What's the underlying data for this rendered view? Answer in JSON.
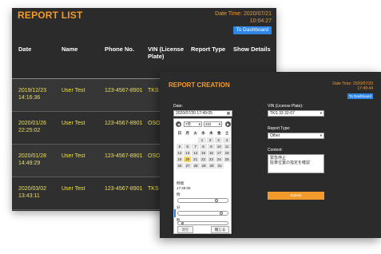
{
  "report_list": {
    "title": "REPORT LIST",
    "datetime_line1": "Date Time: 2020/07/21",
    "datetime_line2": "10:04:27",
    "dashboard_label": "To Dashboard",
    "headers": {
      "date": "Date",
      "name": "Name",
      "phone": "Phone No.",
      "vin": "VIN (License Plate)",
      "report_type": "Report Type",
      "show_details": "Show Details"
    },
    "rows": [
      {
        "date": "2019/12/23",
        "time": "14:16:36",
        "name": "User Test",
        "phone": "123-4567-8901",
        "vin": "TKS"
      },
      {
        "date": "2020/01/26",
        "time": "22:25:02",
        "name": "User Test",
        "phone": "123-4567-8901",
        "vin": "OSO"
      },
      {
        "date": "2020/01/28",
        "time": "14:49:29",
        "name": "User Test",
        "phone": "123-4567-8901",
        "vin": "OSO"
      },
      {
        "date": "2020/03/02",
        "time": "13:43:11",
        "name": "User Test",
        "phone": "123-4567-8901",
        "vin": "TKS"
      }
    ]
  },
  "report_creation": {
    "title": "REPORT CREATION",
    "datetime_line1": "Date Time: 2020/07/20",
    "datetime_line2": "17:49:44",
    "dashboard_label": "To Dashboard",
    "date_label": "Date:",
    "date_value": "2020/07/20 17:49:05",
    "vin_label": "VIN (License Plate):",
    "vin_value": "TKS 33 32-07",
    "report_type_label": "Report Type:",
    "report_type_value": "Other",
    "content_label": "Content:",
    "content_line1": "緊急停止",
    "content_line2": "駐車位置の指定を確認",
    "submit_label": "Submit",
    "picker": {
      "month": "7月",
      "year": "202",
      "weekdays": [
        "日",
        "月",
        "火",
        "水",
        "木",
        "金",
        "土"
      ],
      "weeks": [
        [
          "",
          "",
          "",
          "1",
          "2",
          "3",
          "4"
        ],
        [
          "5",
          "6",
          "7",
          "8",
          "9",
          "10",
          "11"
        ],
        [
          "12",
          "13",
          "14",
          "15",
          "16",
          "17",
          "18"
        ],
        [
          "19",
          "20",
          "21",
          "22",
          "23",
          "24",
          "25"
        ],
        [
          "26",
          "27",
          "28",
          "29",
          "30",
          "31",
          ""
        ]
      ],
      "current_day": "20",
      "time_heading": "時間",
      "time_value": "17:49:05",
      "hour_label": "時",
      "minute_label": "分",
      "second_label": "秒",
      "now_label": "現在",
      "close_label": "閉じる"
    }
  },
  "colors": {
    "accent_orange": "#f39a2c",
    "row_text_yellow": "#f2e23a",
    "button_blue": "#2f86e6",
    "window_bg": "#2b2b2b"
  }
}
